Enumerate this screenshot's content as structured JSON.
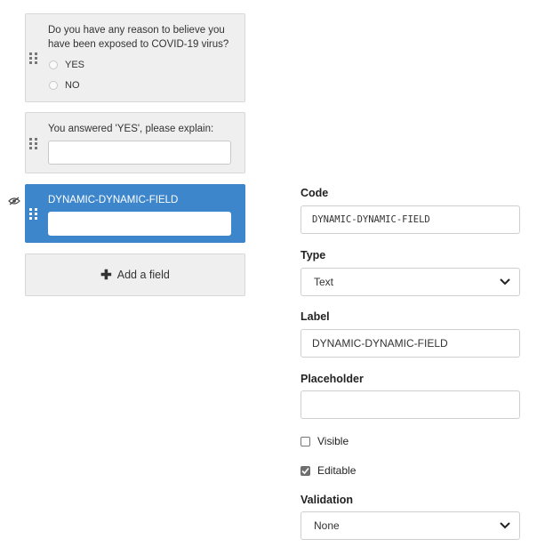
{
  "form_fields": [
    {
      "question": "Do you have any reason to believe you have been exposed to COVID-19 virus?",
      "options": [
        "YES",
        "NO"
      ]
    },
    {
      "question": "You answered 'YES', please explain:"
    },
    {
      "question": "DYNAMIC-DYNAMIC-FIELD"
    }
  ],
  "add_field_label": "Add a field",
  "properties": {
    "code_label": "Code",
    "code_value": "DYNAMIC-DYNAMIC-FIELD",
    "type_label": "Type",
    "type_value": "Text",
    "label_label": "Label",
    "label_value": "DYNAMIC-DYNAMIC-FIELD",
    "placeholder_label": "Placeholder",
    "placeholder_value": "",
    "visible_label": "Visible",
    "visible_checked": false,
    "editable_label": "Editable",
    "editable_checked": true,
    "validation_label": "Validation",
    "validation_value": "None"
  },
  "colors": {
    "selected_card": "#3d86cc",
    "card_background": "#efefef"
  },
  "icons": [
    "drag-handle-icon",
    "eye-slash-icon",
    "plus-icon",
    "chevron-down-icon"
  ]
}
